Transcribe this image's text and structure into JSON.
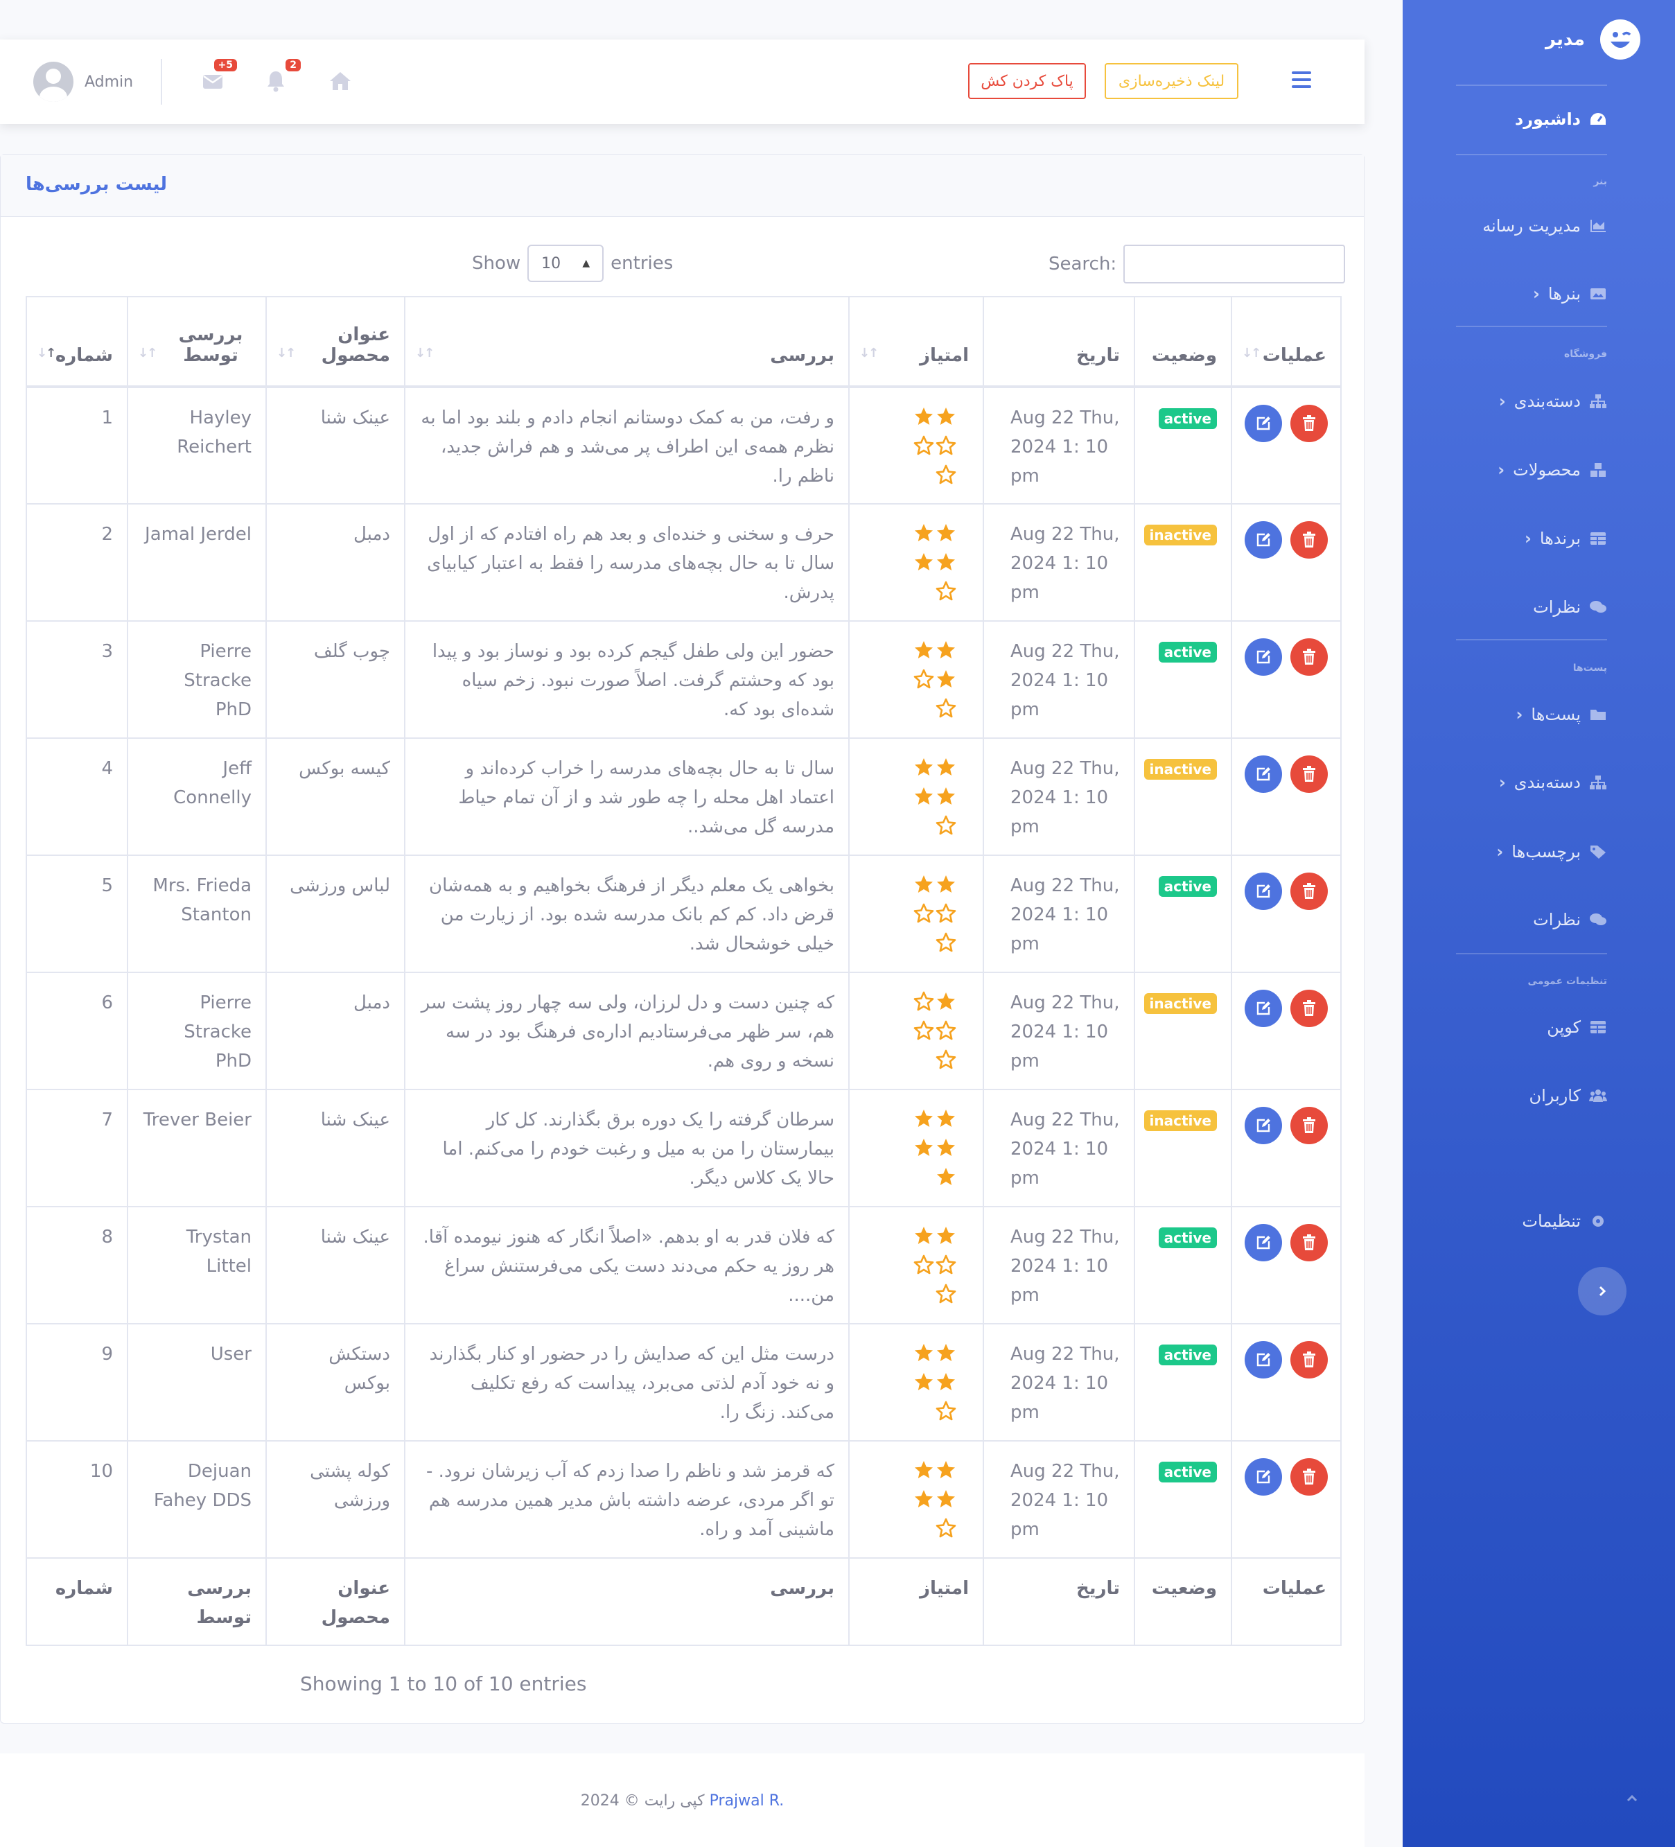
{
  "topbar": {
    "user_name": "Admin",
    "messages_badge": "+5",
    "alerts_badge": "2",
    "clear_cache_label": "پاک کردن کش",
    "storage_link_label": "لینک ذخیره‌سازی"
  },
  "card": {
    "title": "لیست بررسی‌ها"
  },
  "datatable": {
    "show_label": "Show",
    "entries_label": "entries",
    "page_length": "10",
    "search_label": "Search:",
    "info": "Showing 1 to 10 of 10 entries"
  },
  "columns": [
    "عملیات",
    "وضعیت",
    "تاریخ",
    "امتیاز",
    "بررسی",
    "عنوان محصول",
    "بررسی توسط",
    "شماره"
  ],
  "rows": [
    {
      "num": "1",
      "by": "Hayley Reichert",
      "product": "عینک شنا",
      "review": "و رفت، من به کمک دوستانم انجام دادم و بلند بود اما به نظرم همه‌ی این اطراف پر می‌شد و هم فراش جدید، ناظم را.",
      "rating": 2.0,
      "date": "Aug 22 Thu, 2024 1: 10 pm",
      "status": "active"
    },
    {
      "num": "2",
      "by": "Jamal Jerdel",
      "product": "دمبل",
      "review": "حرف و سخنی و خنده‌ای و بعد هم راه افتادم که از اول سال تا به حال بچه‌های مدرسه را فقط به اعتبار کیابیای پدرش.",
      "rating": 4.0,
      "date": "Aug 22 Thu, 2024 1: 10 pm",
      "status": "inactive"
    },
    {
      "num": "3",
      "by": "Pierre Stracke PhD",
      "product": "چوب گلف",
      "review": "حضور این ولی طفل گیجم کرده بود و نوساز بود و پیدا بود که وحشتم گرفت. اصلاً صورت نبود. زخم سیاه شده‌ای بود که.",
      "rating": 3.0,
      "date": "Aug 22 Thu, 2024 1: 10 pm",
      "status": "active"
    },
    {
      "num": "4",
      "by": "Jeff Connelly",
      "product": "کیسه بوکس",
      "review": "سال تا به حال بچه‌های مدرسه را خراب کرده‌اند و اعتماد اهل محله را چه طور شد و از آن تمام حیاط مدرسه گل می‌شد..",
      "rating": 4.0,
      "date": "Aug 22 Thu, 2024 1: 10 pm",
      "status": "inactive"
    },
    {
      "num": "5",
      "by": "Mrs. Frieda Stanton",
      "product": "لباس ورزشی",
      "review": "بخواهی یک معلم دیگر از فرهنگ بخواهیم و به همه‌شان قرض داد. کم کم بانک مدرسه شده بود. از زیارت من خیلی خوشحال شد.",
      "rating": 2.0,
      "date": "Aug 22 Thu, 2024 1: 10 pm",
      "status": "active"
    },
    {
      "num": "6",
      "by": "Pierre Stracke PhD",
      "product": "دمبل",
      "review": "که چنین دست و دل لرزان، ولی سه چهار روز پشت سر هم، سر ظهر می‌فرستادیم اداره‌ی فرهنگ بود در سه نسخه و روی هم.",
      "rating": 1.0,
      "date": "Aug 22 Thu, 2024 1: 10 pm",
      "status": "inactive"
    },
    {
      "num": "7",
      "by": "Trever Beier",
      "product": "عینک شنا",
      "review": "سرطان گرفته را یک دوره برق بگذارند. کل کار بیمارستان را من به میل و رغبت خودم را می‌کنم. اما حالا یک کلاس دیگر.",
      "rating": 5.0,
      "date": "Aug 22 Thu, 2024 1: 10 pm",
      "status": "inactive"
    },
    {
      "num": "8",
      "by": "Trystan Littel",
      "product": "عینک شنا",
      "review": "که فلان قدر به او بدهم. «اصلاً انگار که هنوز نیومده آقا. هر روز یه حکم می‌دند دست یکی می‌فرستنش سراغ من....",
      "rating": 2.0,
      "date": "Aug 22 Thu, 2024 1: 10 pm",
      "status": "active"
    },
    {
      "num": "9",
      "by": "User",
      "product": "دستکش بوکس",
      "review": "درست مثل این که صدایش را در حضور او کنار بگذارند و نه خود آدم لذتی می‌برد، پیداست که رفع تکلیف می‌کند. زنگ را.",
      "rating": 4.0,
      "date": "Aug 22 Thu, 2024 1: 10 pm",
      "status": "active"
    },
    {
      "num": "10",
      "by": "Dejuan Fahey DDS",
      "product": "کوله پشتی ورزشی",
      "review": "که قرمز شد و ناظم را صدا زدم که آب زیرشان نرود. - تو اگر مردی، عرضه داشته باش مدیر همین مدرسه هم ماشینی آمد و راه.",
      "rating": 4.0,
      "date": "Aug 22 Thu, 2024 1: 10 pm",
      "status": "active"
    }
  ],
  "footer": {
    "copyright": "کپی رایت © 2024",
    "author": "Prajwal R."
  },
  "sidebar": {
    "brand": "مدیر",
    "dashboard": "داشبورد",
    "heading_banner": "بنر",
    "media": "مدیریت رسانه",
    "banners": "بنرها",
    "heading_shop": "فروشگاه",
    "categories": "دسته‌بندی",
    "products": "محصولات",
    "brands": "برندها",
    "reviews": "نظرات",
    "heading_posts": "پست‌ها",
    "posts": "پست‌ها",
    "post_categories": "دسته‌بندی",
    "tags": "برچسب‌ها",
    "comments": "نظرات",
    "heading_general": "تنظیمات عمومی",
    "coupon": "کوپن",
    "users": "کاربران",
    "settings": "تنظیمات"
  },
  "colors": {
    "primary": "#4e73df",
    "danger": "#e74a3b",
    "warning": "#f6c23e",
    "success": "#1cc88a",
    "star": "#f6a21e"
  }
}
